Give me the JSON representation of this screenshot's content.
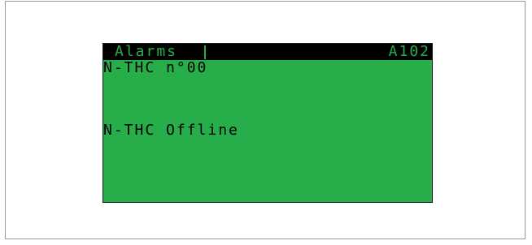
{
  "screen": {
    "header": {
      "title": "Alarms",
      "code": "A102"
    },
    "lines": [
      "N-THC n°00",
      "N-THC Offline"
    ]
  },
  "colors": {
    "lcd_background": "#27ad4a",
    "lcd_text": "#000000",
    "header_background": "#000000"
  }
}
